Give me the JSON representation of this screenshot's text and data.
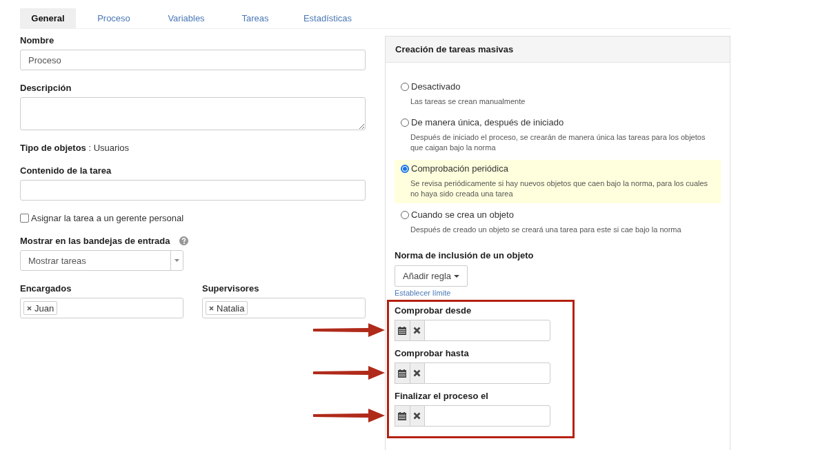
{
  "tabs": [
    {
      "label": "General",
      "selected": true
    },
    {
      "label": "Proceso",
      "selected": false
    },
    {
      "label": "Variables",
      "selected": false
    },
    {
      "label": "Tareas",
      "selected": false
    },
    {
      "label": "Estadísticas",
      "selected": false
    }
  ],
  "general": {
    "name_label": "Nombre",
    "name_value": "Proceso",
    "description_label": "Descripción",
    "object_type_label": "Tipo de objetos",
    "object_type_value": ": Usuarios",
    "task_content_label": "Contenido de la tarea",
    "assign_manager": {
      "label": "Asignar la tarea a un gerente personal",
      "checked": false
    },
    "inbox_label": "Mostrar en las bandejas de entrada",
    "inbox_value": "Mostrar tareas",
    "assignees": {
      "label": "Encargados",
      "tags": [
        "Juan"
      ]
    },
    "supervisors": {
      "label": "Supervisores",
      "tags": [
        "Natalia"
      ]
    }
  },
  "mass_tasks": {
    "title": "Creación de tareas masivas",
    "options": [
      {
        "label": "Desactivado",
        "description": "Las tareas se crean manualmente",
        "selected": false
      },
      {
        "label": "De manera única, después de iniciado",
        "description": "Después de iniciado el proceso, se crearán de manera única las tareas para los objetos que caigan bajo la norma",
        "selected": false
      },
      {
        "label": "Comprobación periódica",
        "description": "Se revisa periódicamente si hay nuevos objetos que caen bajo la norma, para los cuales no haya sido creada una tarea",
        "selected": true
      },
      {
        "label": "Cuando se crea un objeto",
        "description": "Después de creado un objeto se creará una tarea para este si cae bajo la norma",
        "selected": false
      }
    ],
    "rule_label": "Norma de inclusión de un objeto",
    "add_rule_button": "Añadir regla",
    "set_limit_link": "Establecer límite",
    "date_fields": [
      {
        "label": "Comprobar desde"
      },
      {
        "label": "Comprobar hasta"
      },
      {
        "label": "Finalizar el proceso el"
      }
    ]
  }
}
